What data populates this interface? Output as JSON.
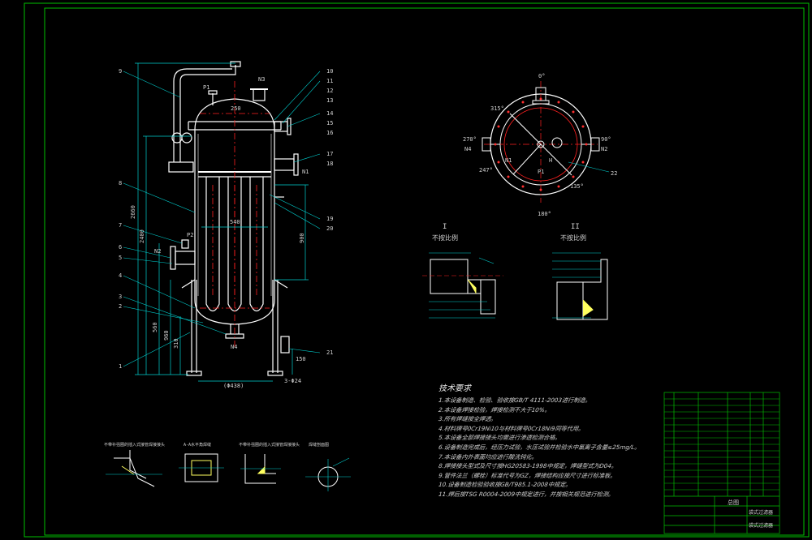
{
  "drawing": {
    "colors": {
      "background": "#000000",
      "frame": "#00c000",
      "shell": "#ffffff",
      "dims": "#00d0d0",
      "centerline": "#ff2020",
      "annotation": "#ffff60",
      "text": "#d0d0d0"
    },
    "nozzle_labels": [
      "P1",
      "N3",
      "P2",
      "N2",
      "N4",
      "N1",
      "H"
    ],
    "dimension_texts": [
      "2660",
      "2400",
      "900",
      "560",
      "960",
      "310",
      "540",
      "(Φ438)",
      "3-Φ24",
      "150",
      "250"
    ],
    "orientation_angles": [
      "0°",
      "315°",
      "270°",
      "90°",
      "247°",
      "135°",
      "180°"
    ],
    "orientation_nozzles": [
      "N4",
      "N2",
      "N1",
      "P1",
      "H"
    ],
    "section_titles": [
      "I",
      "II"
    ],
    "section_subtitles": [
      "不按比例",
      "不按比例"
    ],
    "weld_detail_titles": [
      "不带补强圈的插入式接管焊接接头",
      "A-A水平角焊缝",
      "不带补强圈的插入式接管焊接接头",
      "焊缝剖面图"
    ],
    "leader_numbers_left": [
      "9",
      "8",
      "7",
      "6",
      "5",
      "4",
      "3",
      "2",
      "1"
    ],
    "leader_numbers_right": [
      "10",
      "11",
      "12",
      "13",
      "14",
      "15",
      "16",
      "17",
      "18",
      "19",
      "20",
      "21",
      "22"
    ]
  },
  "notes": {
    "title": "技术要求",
    "items": [
      "1.本设备制造、检验、验收按GB/T 4111-2003进行制造。",
      "2.本设备焊接检验，焊接检测不大于10%。",
      "3.所有焊缝按全焊透。",
      "4.材料牌号0Cr19Ni10与材料牌号0Cr18Ni9同等代用。",
      "5.本设备全部焊接接头均需进行渗透检测合格。",
      "6.设备制造完成后，经压力试验，水压试验并检验水中氯离子含量≤25mg/L。",
      "7.本设备内外表面均应进行酸洗钝化。",
      "8.焊接接头型式及尺寸按HG20583-1998中规定，焊缝型式为D04。",
      "9.管件法兰（螺栓）标准代号为GZ，焊接结构应按尺寸进行标准板。",
      "10.设备制造检验验收按GB/T985.1-2008中规定。",
      "11.焊后按TSG R0004-2009中规定进行，并按相关规范进行检测。"
    ]
  },
  "title_block": {
    "drawing_name": "总图",
    "title": "袋式过滤器",
    "subtitle": "袋式过滤器"
  }
}
